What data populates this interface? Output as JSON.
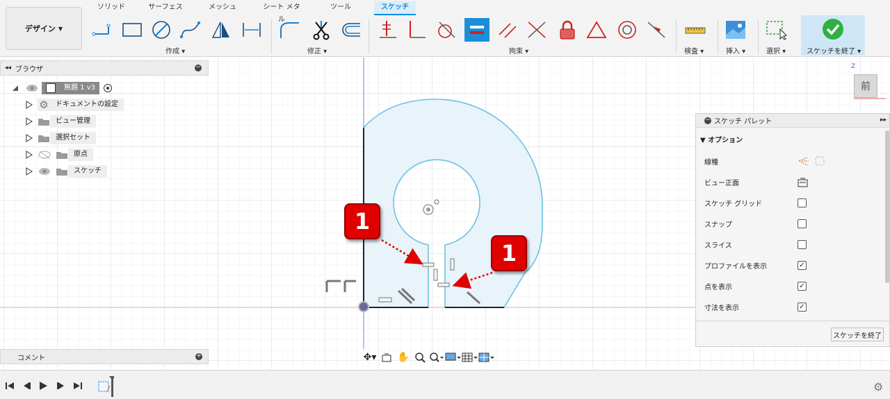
{
  "toolbar": {
    "design_label": "デザイン",
    "tabs": [
      "ソリッド",
      "サーフェス",
      "メッシュ",
      "シート メタル",
      "ツール",
      "スケッチ"
    ],
    "groups": {
      "create": "作成",
      "modify": "修正",
      "constraints": "拘束",
      "inspect": "検査",
      "insert": "挿入",
      "select": "選択",
      "finish": "スケッチを終了"
    }
  },
  "browser": {
    "title": "ブラウザ",
    "root_label": "無題 1 v3",
    "items": [
      {
        "label": "ドキュメントの設定",
        "icon": "gear-icon"
      },
      {
        "label": "ビュー管理",
        "icon": "folder-icon"
      },
      {
        "label": "選択セット",
        "icon": "folder-icon"
      },
      {
        "label": "原点",
        "icon": "folder-icon"
      },
      {
        "label": "スケッチ",
        "icon": "folder-icon"
      }
    ]
  },
  "comments": {
    "label": "コメント"
  },
  "viewcube": {
    "face_label": "前",
    "axis_label": "Z"
  },
  "palette": {
    "title": "スケッチ パレット",
    "section": "オプション",
    "rows": [
      {
        "label": "線種",
        "checked": null
      },
      {
        "label": "ビュー正面",
        "checked": null
      },
      {
        "label": "スケッチ グリッド",
        "checked": false
      },
      {
        "label": "スナップ",
        "checked": false
      },
      {
        "label": "スライス",
        "checked": false
      },
      {
        "label": "プロファイルを表示",
        "checked": true
      },
      {
        "label": "点を表示",
        "checked": true
      },
      {
        "label": "寸法を表示",
        "checked": true
      }
    ],
    "finish_button": "スケッチを終了"
  },
  "callouts": [
    "1",
    "1"
  ],
  "colors": {
    "accent": "#0d8ee0",
    "sketch_line": "#6cc2e0",
    "profile_fill": "#e8f3fa",
    "callout_red": "#e00000",
    "finish_green": "#2fb040"
  }
}
